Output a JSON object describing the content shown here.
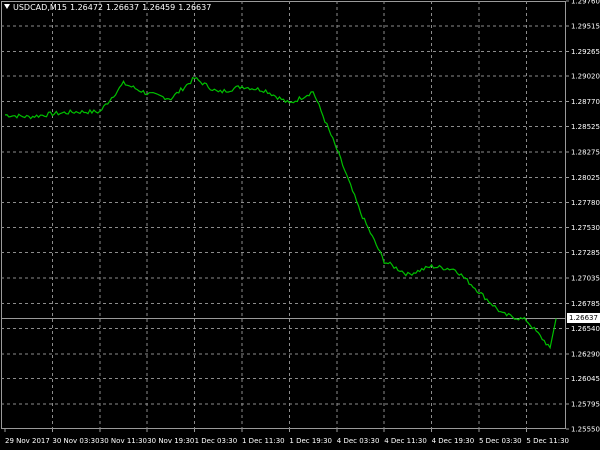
{
  "window": {
    "symbol": "USDCAD,M15",
    "ohlc": [
      "1.26472",
      "1.26637",
      "1.26459",
      "1.26637"
    ]
  },
  "current_price": "1.26637",
  "colors": {
    "background": "#000000",
    "grid": "#8c8c8c",
    "line": "#00c000",
    "current_price_line": "#9a9a9a",
    "text": "#ffffff"
  },
  "chart_data": {
    "type": "line",
    "title": "USDCAD,M15",
    "y_ticks": [
      "1.29760",
      "1.29515",
      "1.29265",
      "1.29020",
      "1.28770",
      "1.28525",
      "1.28275",
      "1.28025",
      "1.27780",
      "1.27530",
      "1.27285",
      "1.27035",
      "1.26785",
      "1.26540",
      "1.26290",
      "1.26045",
      "1.25795",
      "1.25550"
    ],
    "x_ticks": [
      "29 Nov 2017",
      "30 Nov 03:30",
      "30 Nov 11:30",
      "30 Nov 19:30",
      "1 Dec 03:30",
      "1 Dec 11:30",
      "1 Dec 19:30",
      "4 Dec 03:30",
      "4 Dec 11:30",
      "4 Dec 19:30",
      "5 Dec 03:30",
      "5 Dec 11:30"
    ],
    "ylim": [
      1.2555,
      1.2976
    ],
    "grid": true,
    "series": [
      {
        "x": [
          0,
          0.5,
          1,
          1.5,
          2,
          2.5,
          3,
          3.5,
          4,
          4.5,
          5,
          5.5,
          6,
          6.5,
          7,
          7.5,
          8,
          8.5,
          9,
          9.5,
          10,
          10.5,
          11,
          11.5
        ],
        "values": [
          1.2864,
          1.2862,
          1.2865,
          1.2867,
          1.2867,
          1.2895,
          1.2885,
          1.288,
          1.29,
          1.2886,
          1.2892,
          1.2888,
          1.2875,
          1.2887,
          1.283,
          1.2768,
          1.272,
          1.2707,
          1.2715,
          1.2712,
          1.269,
          1.2668,
          1.2662,
          1.2635
        ]
      }
    ]
  }
}
